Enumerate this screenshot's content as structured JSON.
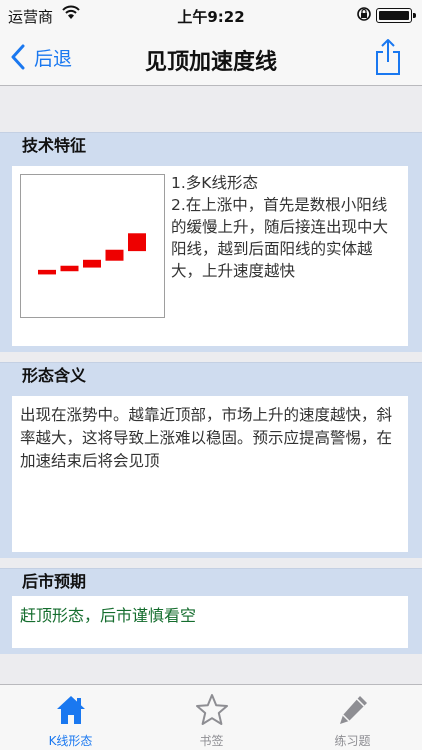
{
  "status_bar": {
    "carrier": "运营商",
    "time": "上午9:22"
  },
  "nav": {
    "back_label": "后退",
    "title": "见顶加速度线"
  },
  "sections": {
    "features": {
      "header": "技术特征",
      "text": "1.多K线形态\n2.在上涨中，首先是数根小阳线的缓慢上升，随后接连出现中大阳线，越到后面阳线的实体越大，上升速度越快"
    },
    "meaning": {
      "header": "形态含义",
      "text": "出现在涨势中。越靠近顶部，市场上升的速度越快，斜率越大，这将导致上涨难以稳固。预示应提高警惕，在加速结束后将会见顶"
    },
    "outlook": {
      "header": "后市预期",
      "text": "赶顶形态，后市谨慎看空"
    }
  },
  "tabs": [
    {
      "label": "K线形态",
      "icon": "home-icon",
      "active": true
    },
    {
      "label": "书签",
      "icon": "star-icon",
      "active": false
    },
    {
      "label": "练习题",
      "icon": "pencil-icon",
      "active": false
    }
  ],
  "colors": {
    "accent": "#1a78f0",
    "candle": "#ee0000",
    "section_bg": "#cfdcef",
    "outlook_text": "#156d2e"
  },
  "chart_data": {
    "type": "candlestick",
    "candles": [
      {
        "open": 10,
        "close": 20
      },
      {
        "open": 17,
        "close": 29
      },
      {
        "open": 25,
        "close": 42
      },
      {
        "open": 40,
        "close": 64
      },
      {
        "open": 61,
        "close": 100
      }
    ],
    "ylim": [
      0,
      140
    ]
  }
}
